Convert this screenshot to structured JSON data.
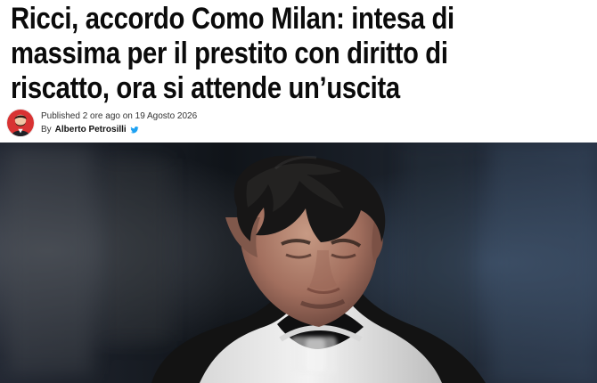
{
  "article": {
    "headline_lines": [
      "Ricci, accordo Como Milan: intesa di",
      "massima per il prestito con diritto di",
      "riscatto, ora si attende un’uscita"
    ],
    "byline": {
      "published_prefix": "Published",
      "published_relative": "2 ore ago",
      "published_on": "on",
      "published_date": "19 Agosto 2026",
      "by_prefix": "By",
      "author": "Alberto Petrosilli",
      "author_social_icon": "twitter-icon",
      "author_avatar_icon": "author-avatar"
    },
    "hero_image": {
      "description_icon": "player-photo"
    }
  },
  "colors": {
    "headline_text": "#0b0b0b",
    "meta_text": "#333333",
    "twitter_blue": "#1da1f2",
    "photo_background": "#1a1f2c",
    "avatar_background": "#d83333"
  }
}
